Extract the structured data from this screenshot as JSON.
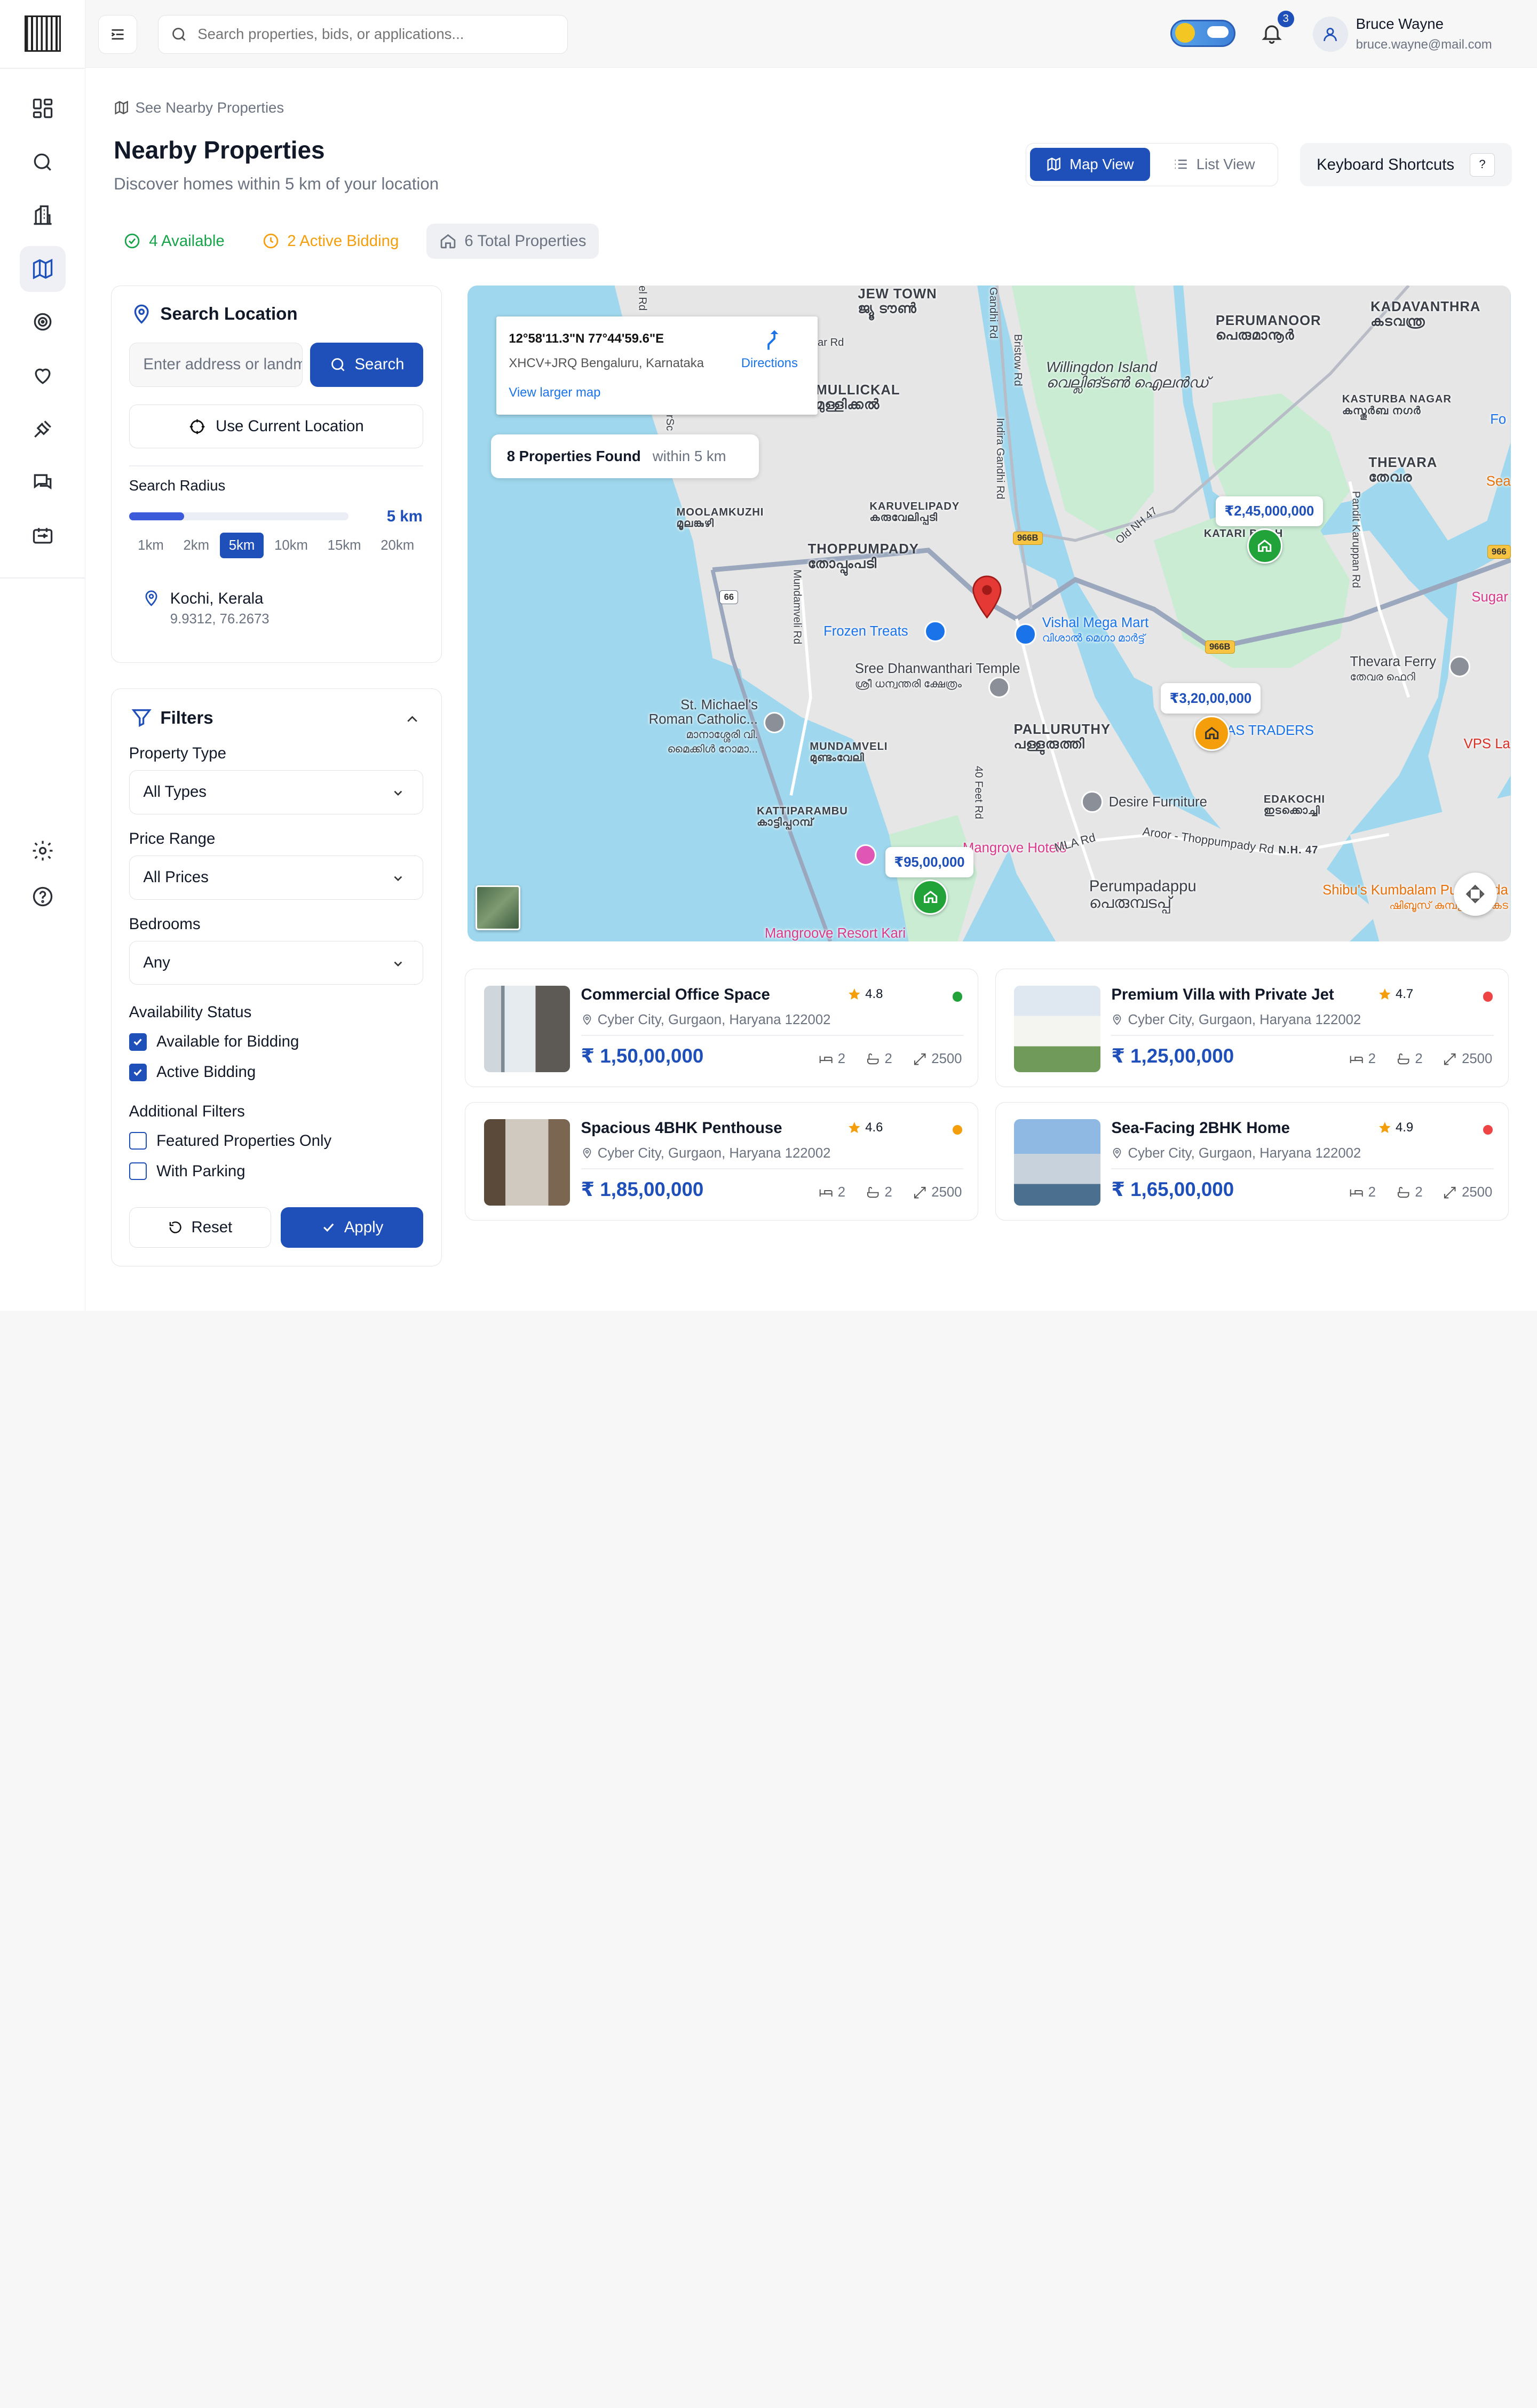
{
  "topbar": {
    "search_placeholder": "Search properties, bids, or applications...",
    "notification_count": "3",
    "user_name": "Bruce Wayne",
    "user_email": "bruce.wayne@mail.com"
  },
  "page": {
    "breadcrumb": "See Nearby Properties",
    "title": "Nearby Properties",
    "subtitle": "Discover homes within 5 km of your location",
    "map_view_label": "Map View",
    "list_view_label": "List View",
    "keyboard_shortcuts_label": "Keyboard Shortcuts",
    "keyboard_key": "?"
  },
  "stats": {
    "available": "4 Available",
    "active_bidding": "2 Active Bidding",
    "total": "6 Total Properties"
  },
  "location_panel": {
    "title": "Search Location",
    "input_placeholder": "Enter address or landmark",
    "search_label": "Search",
    "use_current_label": "Use Current Location",
    "radius_label": "Search Radius",
    "radius_value": "5 km",
    "radius_fill_fraction": 0.25,
    "radius_options": [
      "1km",
      "2km",
      "5km",
      "10km",
      "15km",
      "20km"
    ],
    "radius_selected": "5km",
    "location_name": "Kochi, Kerala",
    "location_coords": "9.9312, 76.2673"
  },
  "filters": {
    "title": "Filters",
    "property_type_label": "Property Type",
    "property_type_value": "All Types",
    "price_range_label": "Price Range",
    "price_range_value": "All Prices",
    "bedrooms_label": "Bedrooms",
    "bedrooms_value": "Any",
    "availability_label": "Availability Status",
    "available_for_bidding": "Available for Bidding",
    "active_bidding": "Active Bidding",
    "additional_label": "Additional Filters",
    "featured_only": "Featured Properties Only",
    "with_parking": "With Parking",
    "reset_label": "Reset",
    "apply_label": "Apply"
  },
  "map": {
    "info_coords": "12°58'11.3\"N 77°44'59.6\"E",
    "info_address": "XHCV+JRQ Bengaluru, Karnataka",
    "info_directions": "Directions",
    "info_larger_map": "View larger map",
    "found_count": "8 Properties Found",
    "found_within": "within 5 km",
    "price_tags": [
      "₹2,45,000,000",
      "₹3,20,00,000",
      "₹95,00,000"
    ],
    "labels": {
      "jew_town": "JEW TOWN",
      "jew_town_ml": "ജ്യൂ ടൗൺ",
      "perumanoor": "PERUMANOOR",
      "perumanoor_ml": "പെരുമാനൂർ",
      "kadavanthra": "KADAVANTHRA",
      "kadavanthra_ml": "കടവന്ത്ര",
      "mullickal": "MULLICKAL",
      "mullickal_ml": "മുള്ളിക്കൽ",
      "willingdon": "Willingdon Island",
      "willingdon_ml": "വെല്ലിങ്ടൺ ഐലൻഡ്",
      "kasturba": "KASTURBA NAGAR",
      "kasturba_ml": "കസ്തൂർബ നഗർ",
      "thevara": "THEVARA",
      "thevara_ml": "തേവര",
      "moolamkuzhi": "MOOLAMKUZHI",
      "moolamkuzhi_ml": "മൂലങ്കുഴി",
      "karuvelipady": "KARUVELIPADY",
      "karuvelipady_ml": "കരുവേലിപ്പടി",
      "thoppumpady": "THOPPUMPADY",
      "thoppumpady_ml": "തോപ്പുംപടി",
      "katari_bagh": "KATARI BAGH",
      "frozen_treats": "Frozen Treats",
      "vishal_mega_mart": "Vishal Mega Mart",
      "vishal_ml": "വിശാൽ മെഗാ മാർട്ട്",
      "sree_dhanwanthari": "Sree Dhanwanthari Temple",
      "sree_ml": "ശ്രീ ധന്വന്തരി ക്ഷേത്രം",
      "thevara_ferry": "Thevara Ferry",
      "thevara_ferry_ml": "തേവര ഫെറി",
      "st_michaels": "St. Michael's Roman Catholic...",
      "st_michaels_ml": "മാനാശ്ശേരി വി. മൈക്കിൾ റോമാ...",
      "palluruthy": "PALLURUTHY",
      "palluruthy_ml": "പള്ളുരുത്തി",
      "as_traders": "AS TRADERS",
      "vps": "VPS La",
      "mundamveli": "MUNDAMVELI",
      "mundamveli_ml": "മുണ്ടംവേലി",
      "kattiparambu": "KATTIPARAMBU",
      "kattiparambu_ml": "കാട്ടിപ്പറമ്പ്",
      "desire_furniture": "Desire Furniture",
      "edakochi": "EDAKOCHI",
      "edakochi_ml": "ഇടക്കൊച്ചി",
      "mangrove_hotels": "Mangrove Hotels",
      "mla_rd": "MLA Rd",
      "aroor_rd": "Aroor - Thoppumpady Rd",
      "nh47": "N.H. 47",
      "perumpadappu": "Perumpadappu",
      "perumpadappu_ml": "പെരുമ്പടപ്പ്",
      "shibus": "Shibu's Kumbalam Puttu Kada",
      "shibus_ml": "ഷിബൂസ് കുമ്പളം പുട്ട് കട",
      "mangroove_resort": "Mangroove Resort Kari",
      "sugar": "Sugar",
      "sea": "Sea",
      "fo": "Fo",
      "gandhi_rd": "Gandhi Rd",
      "bristow_rd": "Bristow Rd",
      "indira_gandhi_rd": "Indira Gandhi Rd",
      "old_nh47": "Old NH 47",
      "pandit_karuppan_rd": "Pandit Karuppan Rd",
      "mundamveli_rd": "Mundamveli Rd",
      "forty_feet_rd": "40 Feet Rd",
      "el_rd": "el Rd",
      "ar_rd": "ar Rd",
      "rsc": "rSc"
    },
    "shields": [
      "966B",
      "966B",
      "66",
      "966"
    ]
  },
  "properties": [
    {
      "title": "Commercial Office Space",
      "rating": "4.8",
      "status_color": "#22a33a",
      "address": "Cyber City, Gurgaon, Haryana 122002",
      "price": "₹ 1,50,00,000",
      "beds": "2",
      "baths": "2",
      "area": "2500"
    },
    {
      "title": "Premium Villa with Private Jet",
      "rating": "4.7",
      "status_color": "#ef4444",
      "address": "Cyber City, Gurgaon, Haryana 122002",
      "price": "₹ 1,25,00,000",
      "beds": "2",
      "baths": "2",
      "area": "2500"
    },
    {
      "title": "Spacious 4BHK Penthouse",
      "rating": "4.6",
      "status_color": "#f59e0b",
      "address": "Cyber City, Gurgaon, Haryana 122002",
      "price": "₹ 1,85,00,000",
      "beds": "2",
      "baths": "2",
      "area": "2500"
    },
    {
      "title": "Sea-Facing 2BHK Home",
      "rating": "4.9",
      "status_color": "#ef4444",
      "address": "Cyber City, Gurgaon, Haryana 122002",
      "price": "₹ 1,65,00,000",
      "beds": "2",
      "baths": "2",
      "area": "2500"
    }
  ]
}
